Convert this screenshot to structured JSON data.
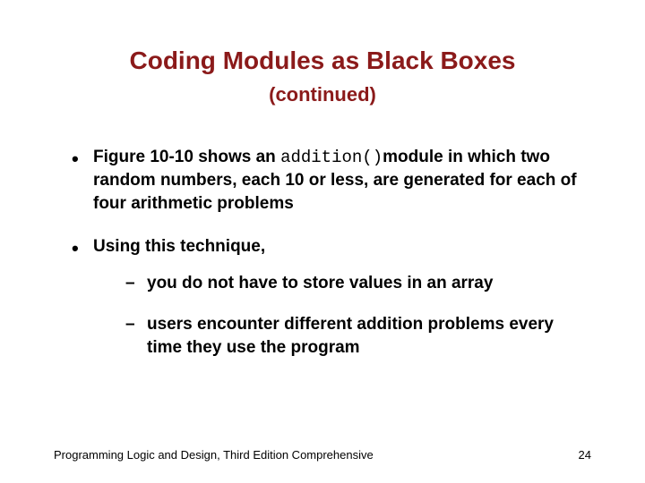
{
  "title": {
    "main": "Coding Modules as Black Boxes",
    "sub_open": "(",
    "sub_text": "continued",
    "sub_close": ")"
  },
  "bullets": {
    "b1_pre": "Figure 10-10 shows an ",
    "b1_code": "addition()",
    "b1_post": "module in which two random numbers, each 10 or less, are generated for each of four arithmetic problems",
    "b2": "Using this technique,",
    "b2_sub1": "you do not have to store values in an array",
    "b2_sub2": "users encounter different addition problems every time they use the program"
  },
  "footer": {
    "left": "Programming Logic and Design, Third Edition Comprehensive",
    "right": "24"
  }
}
